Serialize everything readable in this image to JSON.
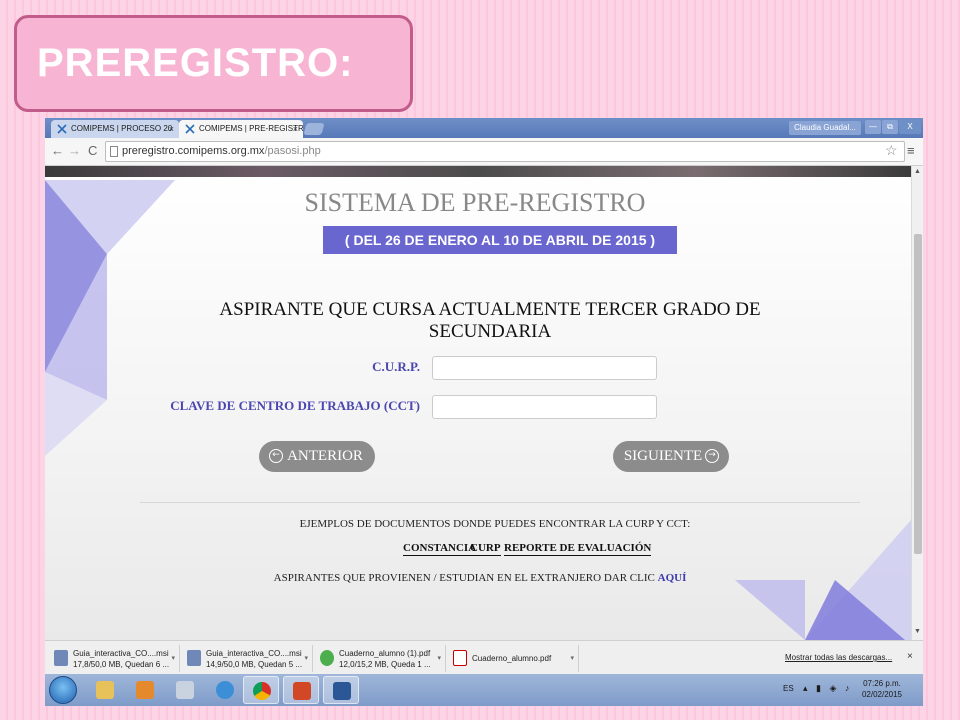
{
  "slide": {
    "title": "PREREGISTRO:"
  },
  "browser": {
    "tabs": [
      {
        "label": "COMIPEMS | PROCESO 20"
      },
      {
        "label": "COMIPEMS | PRE-REGISTR"
      }
    ],
    "user_label": "Claudia Guadal...",
    "window_buttons": {
      "minimize": "—",
      "maximize": "⧉",
      "close": "X"
    },
    "url_host": "preregistro.comipems.org.mx",
    "url_path": "/pasosi.php"
  },
  "page": {
    "system_title": "SISTEMA DE PRE-REGISTRO",
    "date_range": "( DEL 26 DE ENERO AL 10 DE ABRIL DE 2015 )",
    "heading": "ASPIRANTE QUE CURSA ACTUALMENTE TERCER GRADO DE SECUNDARIA",
    "form": {
      "curp_label": "C.U.R.P.",
      "curp_value": "",
      "cct_label": "CLAVE DE CENTRO DE TRABAJO (CCT)",
      "cct_value": ""
    },
    "buttons": {
      "previous": "ANTERIOR",
      "next": "SIGUIENTE"
    },
    "examples_text": "EJEMPLOS DE DOCUMENTOS DONDE PUEDES ENCONTRAR LA CURP Y CCT:",
    "document_links": [
      "CONSTANCIA",
      "CURP",
      "REPORTE DE EVALUACIÓN"
    ],
    "foreign_text": "ASPIRANTES QUE PROVIENEN / ESTUDIAN EN EL EXTRANJERO DAR CLIC ",
    "foreign_link": "AQUÍ",
    "accent_color": "#6a66cf"
  },
  "downloads": {
    "items": [
      {
        "name": "Guia_interactiva_CO....msi",
        "status": "17,8/50,0 MB, Quedan 6 ..."
      },
      {
        "name": "Guia_interactiva_CO....msi",
        "status": "14,9/50,0 MB, Quedan 5 ..."
      },
      {
        "name": "Cuaderno_alumno (1).pdf",
        "status": "12,0/15,2 MB, Queda 1 ..."
      },
      {
        "name": "Cuaderno_alumno.pdf",
        "status": ""
      }
    ],
    "show_all": "Mostrar todas las descargas...",
    "close": "×"
  },
  "taskbar": {
    "language": "ES",
    "time": "07:26 p.m.",
    "date": "02/02/2015"
  }
}
